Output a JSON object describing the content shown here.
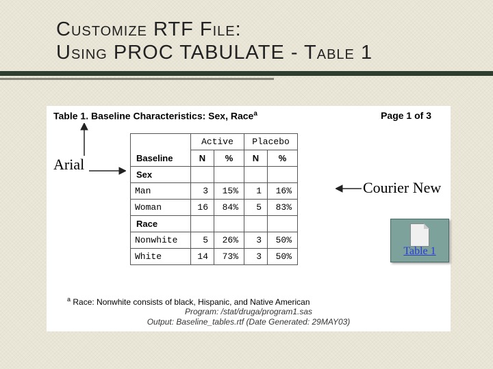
{
  "slide": {
    "title_line1": "Customize RTF File:",
    "title_line2": "Using PROC TABULATE - Table 1"
  },
  "panel": {
    "table_title": "Table 1. Baseline Characteristics: Sex, Race",
    "table_title_super": "a",
    "page_label": "Page 1 of 3",
    "headers": {
      "baseline": "Baseline",
      "group1": "Active",
      "group2": "Placebo",
      "n": "N",
      "pct": "%"
    },
    "section1": "Sex",
    "rows_sex": [
      {
        "label": "Man",
        "n1": "3",
        "p1": "15%",
        "n2": "1",
        "p2": "16%"
      },
      {
        "label": "Woman",
        "n1": "16",
        "p1": "84%",
        "n2": "5",
        "p2": "83%"
      }
    ],
    "section2": "Race",
    "rows_race": [
      {
        "label": "Nonwhite",
        "n1": "5",
        "p1": "26%",
        "n2": "3",
        "p2": "50%"
      },
      {
        "label": "White",
        "n1": "14",
        "p1": "73%",
        "n2": "3",
        "p2": "50%"
      }
    ],
    "footnote_super": "a",
    "footnote": " Race: Nonwhite consists of black, Hispanic, and Native American",
    "meta_line1": "Program: /stat/druga/program1.sas",
    "meta_line2": "Output: Baseline_tables.rtf (Date Generated: 29MAY03)"
  },
  "annotations": {
    "arial": "Arial",
    "courier": "Courier New",
    "doc_link": "Table 1"
  }
}
